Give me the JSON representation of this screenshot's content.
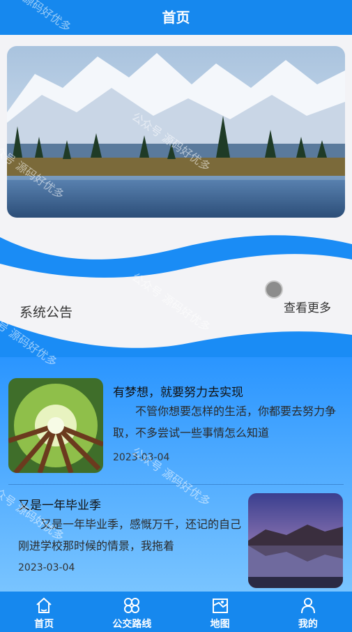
{
  "header": {
    "title": "首页"
  },
  "notice": {
    "title": "系统公告",
    "more": "查看更多"
  },
  "articles": [
    {
      "title": "有梦想，就要努力去实现",
      "summary": "不管你想要怎样的生活，你都要去努力争取，不多尝试一些事情怎么知道",
      "date": "2023-03-04",
      "thumb_icon": "forest-image"
    },
    {
      "title": "又是一年毕业季",
      "summary": "又是一年毕业季，感慨万千，还记的自己刚进学校那时候的情景，我拖着",
      "date": "2023-03-04",
      "thumb_icon": "lake-mountain-image"
    }
  ],
  "tabs": [
    {
      "label": "首页",
      "icon": "home-icon"
    },
    {
      "label": "公交路线",
      "icon": "grid-icon"
    },
    {
      "label": "地图",
      "icon": "map-icon"
    },
    {
      "label": "我的",
      "icon": "user-icon"
    }
  ],
  "watermark": "公众号 源码好优多",
  "colors": {
    "primary": "#1688ee",
    "wave": "#1a8cf5"
  }
}
